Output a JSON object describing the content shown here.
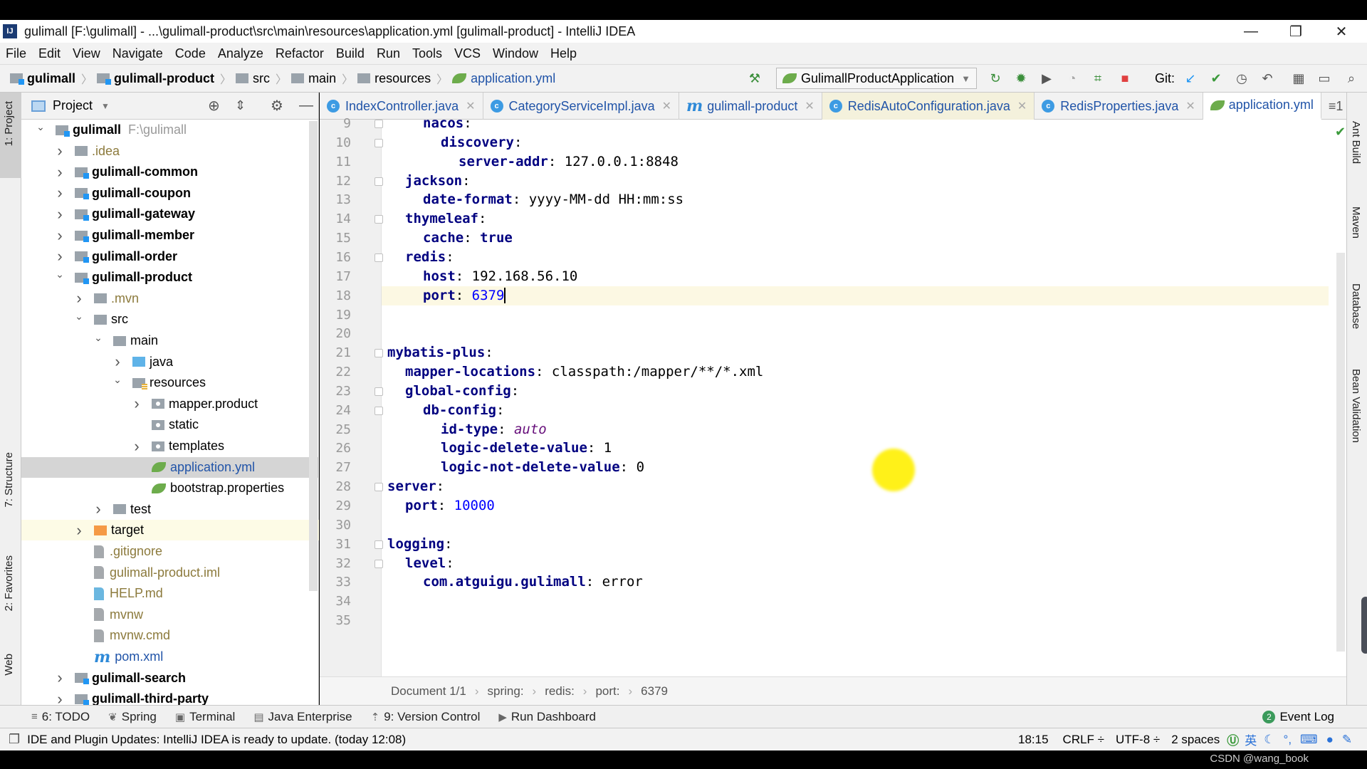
{
  "window": {
    "title": "gulimall [F:\\gulimall] - ...\\gulimall-product\\src\\main\\resources\\application.yml [gulimall-product] - IntelliJ IDEA",
    "logo": "IJ",
    "controls": {
      "minimize": "—",
      "restore": "❐",
      "close": "✕"
    }
  },
  "menu": [
    "File",
    "Edit",
    "View",
    "Navigate",
    "Code",
    "Analyze",
    "Refactor",
    "Build",
    "Run",
    "Tools",
    "VCS",
    "Window",
    "Help"
  ],
  "navbar": {
    "breadcrumbs": [
      "gulimall",
      "gulimall-product",
      "src",
      "main",
      "resources",
      "application.yml"
    ],
    "run_config": "GulimallProductApplication",
    "git_label": "Git:"
  },
  "project_panel": {
    "title": "Project",
    "side_tabs": {
      "project": "1: Project",
      "structure": "7: Structure",
      "favorites": "2: Favorites",
      "web": "Web"
    },
    "tree": [
      {
        "label": "gulimall",
        "hint": "F:\\gulimall",
        "depth": 0,
        "arrow": "down",
        "icon": "module",
        "bold": true
      },
      {
        "label": ".idea",
        "depth": 1,
        "arrow": "right",
        "icon": "folder",
        "color": "#8c7a3c"
      },
      {
        "label": "gulimall-common",
        "depth": 1,
        "arrow": "right",
        "icon": "module",
        "bold": true
      },
      {
        "label": "gulimall-coupon",
        "depth": 1,
        "arrow": "right",
        "icon": "module",
        "bold": true
      },
      {
        "label": "gulimall-gateway",
        "depth": 1,
        "arrow": "right",
        "icon": "module",
        "bold": true
      },
      {
        "label": "gulimall-member",
        "depth": 1,
        "arrow": "right",
        "icon": "module",
        "bold": true
      },
      {
        "label": "gulimall-order",
        "depth": 1,
        "arrow": "right",
        "icon": "module",
        "bold": true
      },
      {
        "label": "gulimall-product",
        "depth": 1,
        "arrow": "down",
        "icon": "module",
        "bold": true
      },
      {
        "label": ".mvn",
        "depth": 2,
        "arrow": "right",
        "icon": "folder",
        "color": "#8c7a3c"
      },
      {
        "label": "src",
        "depth": 2,
        "arrow": "down",
        "icon": "folder"
      },
      {
        "label": "main",
        "depth": 3,
        "arrow": "down",
        "icon": "folder"
      },
      {
        "label": "java",
        "depth": 4,
        "arrow": "right",
        "icon": "folder-blue"
      },
      {
        "label": "resources",
        "depth": 4,
        "arrow": "down",
        "icon": "folder-res"
      },
      {
        "label": "mapper.product",
        "depth": 5,
        "arrow": "right",
        "icon": "folder-pkg"
      },
      {
        "label": "static",
        "depth": 5,
        "arrow": "none",
        "icon": "folder-pkg"
      },
      {
        "label": "templates",
        "depth": 5,
        "arrow": "right",
        "icon": "folder-pkg"
      },
      {
        "label": "application.yml",
        "depth": 5,
        "arrow": "none",
        "icon": "spring",
        "color": "#2154a8",
        "selected": true
      },
      {
        "label": "bootstrap.properties",
        "depth": 5,
        "arrow": "none",
        "icon": "spring"
      },
      {
        "label": "test",
        "depth": 3,
        "arrow": "right",
        "icon": "folder"
      },
      {
        "label": "target",
        "depth": 2,
        "arrow": "right",
        "icon": "folder-orange",
        "highlight": true
      },
      {
        "label": ".gitignore",
        "depth": 2,
        "arrow": "none",
        "icon": "file",
        "color": "#8c7a3c"
      },
      {
        "label": "gulimall-product.iml",
        "depth": 2,
        "arrow": "none",
        "icon": "file",
        "color": "#8c7a3c"
      },
      {
        "label": "HELP.md",
        "depth": 2,
        "arrow": "none",
        "icon": "md",
        "color": "#8c7a3c"
      },
      {
        "label": "mvnw",
        "depth": 2,
        "arrow": "none",
        "icon": "file",
        "color": "#8c7a3c"
      },
      {
        "label": "mvnw.cmd",
        "depth": 2,
        "arrow": "none",
        "icon": "file",
        "color": "#8c7a3c"
      },
      {
        "label": "pom.xml",
        "depth": 2,
        "arrow": "none",
        "icon": "maven",
        "color": "#2154a8"
      },
      {
        "label": "gulimall-search",
        "depth": 1,
        "arrow": "right",
        "icon": "module",
        "bold": true
      },
      {
        "label": "gulimall-third-party",
        "depth": 1,
        "arrow": "right",
        "icon": "module",
        "bold": true
      }
    ]
  },
  "editor": {
    "tabs": [
      {
        "label": "IndexController.java",
        "icon": "class"
      },
      {
        "label": "CategoryServiceImpl.java",
        "icon": "class"
      },
      {
        "label": "gulimall-product",
        "icon": "maven"
      },
      {
        "label": "RedisAutoConfiguration.java",
        "icon": "class",
        "yellow": true
      },
      {
        "label": "RedisProperties.java",
        "icon": "class"
      },
      {
        "label": "application.yml",
        "icon": "spring",
        "active": true
      }
    ],
    "tab_overflow": "≡1",
    "lines": [
      {
        "n": 9,
        "indent": 2,
        "key": "nacos",
        "val": ""
      },
      {
        "n": 10,
        "indent": 3,
        "key": "discovery",
        "val": ""
      },
      {
        "n": 11,
        "indent": 4,
        "key": "server-addr",
        "val": "127.0.0.1:8848",
        "vt": "v"
      },
      {
        "n": 12,
        "indent": 1,
        "key": "jackson",
        "val": ""
      },
      {
        "n": 13,
        "indent": 2,
        "key": "date-format",
        "val": "yyyy-MM-dd HH:mm:ss",
        "vt": "v"
      },
      {
        "n": 14,
        "indent": 1,
        "key": "thymeleaf",
        "val": ""
      },
      {
        "n": 15,
        "indent": 2,
        "key": "cache",
        "val": "true",
        "vt": "k"
      },
      {
        "n": 16,
        "indent": 1,
        "key": "redis",
        "val": ""
      },
      {
        "n": 17,
        "indent": 2,
        "key": "host",
        "val": "192.168.56.10",
        "vt": "v"
      },
      {
        "n": 18,
        "indent": 2,
        "key": "port",
        "val": "6379",
        "vt": "n",
        "current": true
      },
      {
        "n": 19,
        "indent": 0,
        "key": "",
        "val": ""
      },
      {
        "n": 20,
        "indent": 0,
        "key": "",
        "val": ""
      },
      {
        "n": 21,
        "indent": 0,
        "key": "mybatis-plus",
        "val": ""
      },
      {
        "n": 22,
        "indent": 1,
        "key": "mapper-locations",
        "val": "classpath:/mapper/**/*.xml",
        "vt": "v"
      },
      {
        "n": 23,
        "indent": 1,
        "key": "global-config",
        "val": ""
      },
      {
        "n": 24,
        "indent": 2,
        "key": "db-config",
        "val": ""
      },
      {
        "n": 25,
        "indent": 3,
        "key": "id-type",
        "val": "auto",
        "vt": "i"
      },
      {
        "n": 26,
        "indent": 3,
        "key": "logic-delete-value",
        "val": "1",
        "vt": "v"
      },
      {
        "n": 27,
        "indent": 3,
        "key": "logic-not-delete-value",
        "val": "0",
        "vt": "v"
      },
      {
        "n": 28,
        "indent": 0,
        "key": "server",
        "val": ""
      },
      {
        "n": 29,
        "indent": 1,
        "key": "port",
        "val": "10000",
        "vt": "n"
      },
      {
        "n": 30,
        "indent": 0,
        "key": "",
        "val": ""
      },
      {
        "n": 31,
        "indent": 0,
        "key": "logging",
        "val": ""
      },
      {
        "n": 32,
        "indent": 1,
        "key": "level",
        "val": ""
      },
      {
        "n": 33,
        "indent": 2,
        "key": "com.atguigu.gulimall",
        "val": "error",
        "vt": "v"
      },
      {
        "n": 34,
        "indent": 0,
        "key": "",
        "val": ""
      },
      {
        "n": 35,
        "indent": 0,
        "key": "",
        "val": ""
      }
    ],
    "breadcrumb": [
      "Document 1/1",
      "spring:",
      "redis:",
      "port:",
      "6379"
    ]
  },
  "right_strip": [
    "Ant Build",
    "Maven",
    "Database",
    "Bean Validation"
  ],
  "tool_windows": [
    {
      "label": "6: TODO",
      "icon": "≡"
    },
    {
      "label": "Spring",
      "icon": "❦"
    },
    {
      "label": "Terminal",
      "icon": "▣"
    },
    {
      "label": "Java Enterprise",
      "icon": "▤"
    },
    {
      "label": "9: Version Control",
      "icon": "⇡"
    },
    {
      "label": "Run Dashboard",
      "icon": "▶"
    }
  ],
  "event_log": {
    "label": "Event Log",
    "count": "2"
  },
  "status": {
    "message": "IDE and Plugin Updates: IntelliJ IDEA is ready to update. (today 12:08)",
    "position": "18:15",
    "line_sep": "CRLF ÷",
    "encoding": "UTF-8 ÷",
    "indent": "2 spaces",
    "ime": "英"
  },
  "watermark": "CSDN @wang_book",
  "colors": {
    "accent": "#2154a8",
    "key": "#000080",
    "number": "#0000ff",
    "current_line": "#fcf8e3"
  }
}
